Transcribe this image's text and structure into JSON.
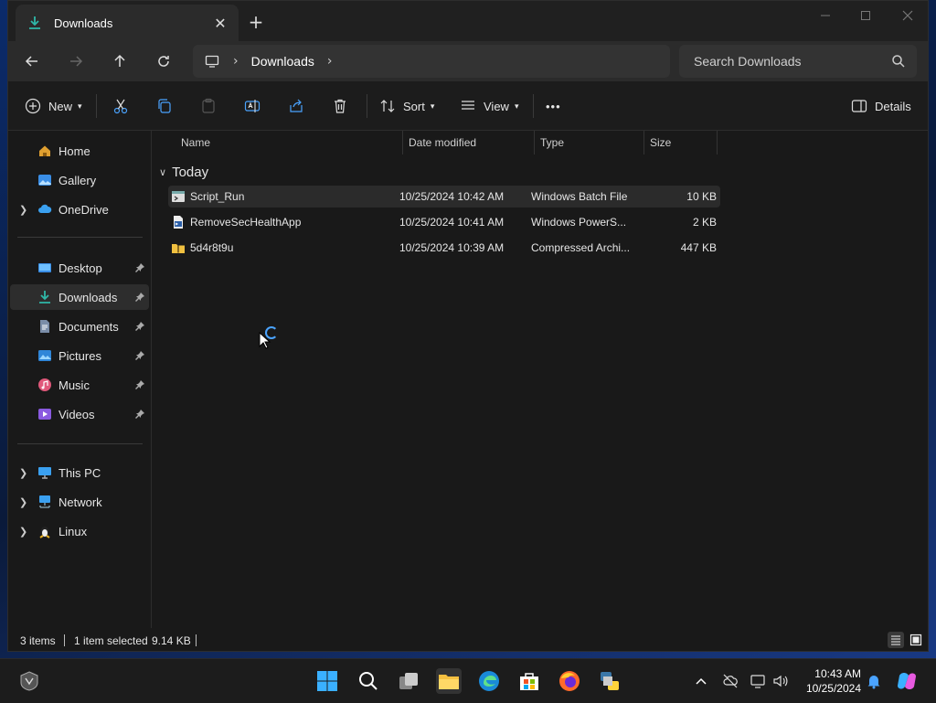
{
  "window": {
    "tab_title": "Downloads",
    "close_tab": "✕",
    "new_tab": "+"
  },
  "navigation": {
    "breadcrumb": [
      "Downloads"
    ],
    "search_placeholder": "Search Downloads"
  },
  "toolbar": {
    "new_label": "New",
    "sort_label": "Sort",
    "view_label": "View",
    "more_label": "•••",
    "details_label": "Details"
  },
  "sidebar": {
    "items": [
      {
        "label": "Home",
        "icon": "home-icon"
      },
      {
        "label": "Gallery",
        "icon": "gallery-icon"
      },
      {
        "label": "OneDrive",
        "icon": "onedrive-icon"
      },
      {
        "label": "Desktop",
        "icon": "desktop-icon"
      },
      {
        "label": "Downloads",
        "icon": "download-icon"
      },
      {
        "label": "Documents",
        "icon": "documents-icon"
      },
      {
        "label": "Pictures",
        "icon": "pictures-icon"
      },
      {
        "label": "Music",
        "icon": "music-icon"
      },
      {
        "label": "Videos",
        "icon": "videos-icon"
      },
      {
        "label": "This PC",
        "icon": "this-pc-icon"
      },
      {
        "label": "Network",
        "icon": "network-icon"
      },
      {
        "label": "Linux",
        "icon": "linux-icon"
      }
    ]
  },
  "file_list": {
    "columns": [
      "Name",
      "Date modified",
      "Type",
      "Size"
    ],
    "group": "Today",
    "rows": [
      {
        "name": "Script_Run",
        "date": "10/25/2024 10:42 AM",
        "type": "Windows Batch File",
        "size": "10 KB"
      },
      {
        "name": "RemoveSecHealthApp",
        "date": "10/25/2024 10:41 AM",
        "type": "Windows PowerS...",
        "size": "2 KB"
      },
      {
        "name": "5d4r8t9u",
        "date": "10/25/2024 10:39 AM",
        "type": "Compressed Archi...",
        "size": "447 KB"
      }
    ]
  },
  "status": {
    "item_count": "3 items",
    "selection": "1 item selected",
    "selection_size": "9.14 KB"
  },
  "taskbar": {
    "time": "10:43 AM",
    "date": "10/25/2024"
  },
  "colors": {
    "accent": "#4aa3ff",
    "background": "#191919",
    "selected_row": "#2b2b2b"
  }
}
